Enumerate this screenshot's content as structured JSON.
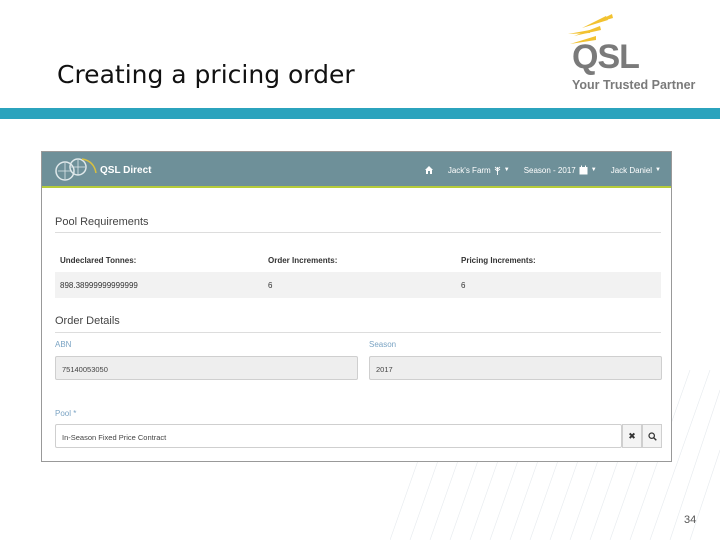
{
  "slide": {
    "title": "Creating a pricing order",
    "page_number": "34"
  },
  "logo": {
    "text": "QSL",
    "tagline": "Your Trusted Partner"
  },
  "app": {
    "brand": "QSL Direct",
    "nav": {
      "farm": "Jack's Farm",
      "season": "Season - 2017",
      "user": "Jack Daniel"
    },
    "pool_requirements": {
      "title": "Pool Requirements",
      "columns": [
        "Undeclared Tonnes:",
        "Order Increments:",
        "Pricing Increments:"
      ],
      "values": [
        "898.38999999999999",
        "6",
        "6"
      ]
    },
    "order_details": {
      "title": "Order Details",
      "abn_label": "ABN",
      "abn_value": "75140053050",
      "season_label": "Season",
      "season_value": "2017",
      "pool_label": "Pool *",
      "pool_value": "In-Season Fixed Price Contract"
    }
  },
  "colors": {
    "band": "#2ba3bd",
    "nav_bg": "#6e9099",
    "nav_accent": "#b6cc3a",
    "logo_gold": "#f2c230"
  }
}
